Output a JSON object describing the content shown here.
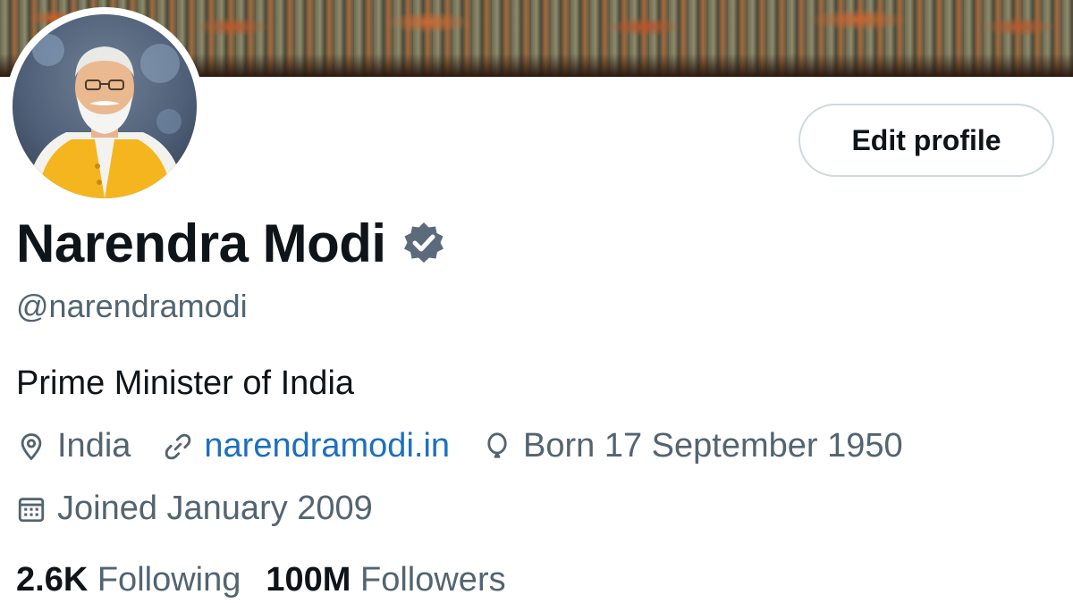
{
  "profile": {
    "name": "Narendra Modi",
    "handle": "@narendramodi",
    "bio": "Prime Minister of India",
    "location": "India",
    "website": "narendramodi.in",
    "birthday": "Born 17 September 1950",
    "joined": "Joined January 2009",
    "verified": true
  },
  "buttons": {
    "edit_profile": "Edit profile"
  },
  "stats": {
    "following_count": "2.6K",
    "following_label": "Following",
    "followers_count": "100M",
    "followers_label": "Followers"
  },
  "icons": {
    "verified": "verified-badge-icon",
    "location": "location-pin-icon",
    "link": "link-icon",
    "birthday": "balloon-icon",
    "joined": "calendar-icon"
  },
  "colors": {
    "text_primary": "#0f1419",
    "text_secondary": "#536471",
    "link": "#1d6fbf",
    "verified_badge": "#5b6b7c",
    "button_border": "#cfd9de"
  }
}
